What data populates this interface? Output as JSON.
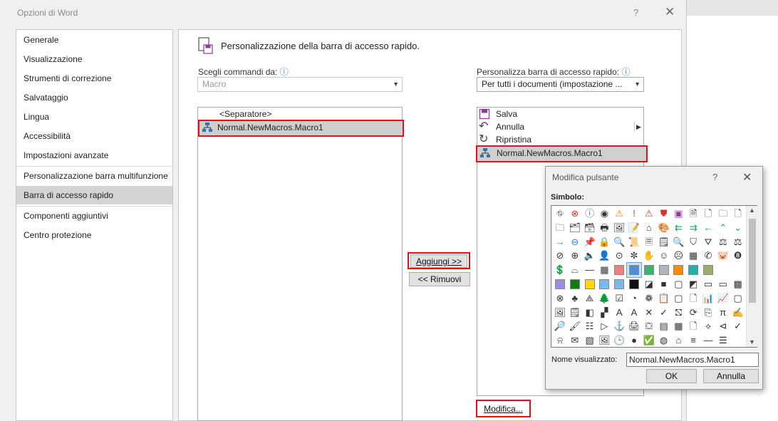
{
  "window": {
    "title": "Opzioni di Word",
    "help": "?",
    "close": "✕"
  },
  "nav": {
    "items": [
      "Generale",
      "Visualizzazione",
      "Strumenti di correzione",
      "Salvataggio",
      "Lingua",
      "Accessibilità",
      "Impostazioni avanzate",
      "Personalizzazione barra multifunzione",
      "Barra di accesso rapido",
      "Componenti aggiuntivi",
      "Centro protezione"
    ],
    "selected_index": 8
  },
  "main": {
    "header": "Personalizzazione della barra di accesso rapido.",
    "choose_label": "Scegli commandi da:",
    "choose_value": "Macro",
    "customize_label": "Personalizza barra di accesso rapido:",
    "customize_value": "Per tutti i documenti (impostazione ...",
    "left_list": [
      "<Separatore>",
      "Normal.NewMacros.Macro1"
    ],
    "right_list": [
      "Salva",
      "Annulla",
      "Ripristina",
      "Normal.NewMacros.Macro1"
    ],
    "add_button": "Aggiungi >>",
    "remove_button": "<< Rimuovi",
    "modify_button": "Modifica..."
  },
  "dialog": {
    "title": "Modifica pulsante",
    "help": "?",
    "close": "✕",
    "symbol_label": "Simbolo:",
    "display_name_label": "Nome visualizzato:",
    "display_name_value": "Normal.NewMacros.Macro1",
    "ok": "OK",
    "cancel": "Annulla"
  },
  "icons": {
    "symbols": [
      "⛗",
      "⊗",
      "ⓘ",
      "◉",
      "⚠",
      "!",
      "⚠",
      "⛊",
      "▣",
      "🗎",
      "🗋",
      "🗀",
      "🗋",
      "🗀",
      "🗂",
      "🗃",
      "🖶",
      "🖼",
      "📝",
      "⌂",
      "🎨",
      "⇇",
      "⇉",
      "←",
      "⌃",
      "⌄",
      "→",
      "⊖",
      "📌",
      "🔒",
      "🔍",
      "📜",
      "🗏",
      "🗒",
      "🔍",
      "⛉",
      "⛛",
      "⚖",
      "⚖",
      "⊘",
      "⊕",
      "🔈",
      "👤",
      "⊙",
      "✼",
      "✋",
      "☺",
      "☹",
      "▦",
      "✆",
      "🐷",
      "❽",
      "💲",
      "⌓",
      "—",
      "▦",
      "□",
      "",
      "",
      "",
      "",
      "",
      "",
      "",
      "",
      "",
      "",
      "",
      "",
      "",
      "",
      "◪",
      "■",
      "▢",
      "◩",
      "▭",
      "▭",
      "▩",
      "⊗",
      "♣",
      "⟁",
      "🌲",
      "☑",
      "◔",
      "❁",
      "📋",
      "▢",
      "🗋",
      "📊",
      "📈",
      "▢",
      "🖼",
      "🗒",
      "◧",
      "▞",
      "A",
      "A",
      "✕",
      "✓",
      "⛞",
      "⟳",
      "⎘",
      "π",
      "✍",
      "🔎",
      "🖌",
      "☷",
      "▷",
      "⚓",
      "🖨",
      "⛋",
      "▤",
      "▦",
      "🗋",
      "⟡",
      "⊲",
      "✓",
      "⍾",
      "✉",
      "▧",
      "🖼",
      "🕒",
      "●",
      "✅",
      "◍",
      "⌂",
      "≡",
      "—",
      "☰"
    ],
    "swatches": {
      "red": "#f08080",
      "blue": "#4a90d9",
      "green": "#3cb371",
      "gray": "#b0b4bc",
      "orange": "#ff8c00",
      "teal": "#20b2aa",
      "olive": "#9aac6e",
      "lavender": "#9b8fe0",
      "darkgreen": "#107c10",
      "yellow": "#ffd800",
      "sky": "#7cb9e8"
    }
  }
}
